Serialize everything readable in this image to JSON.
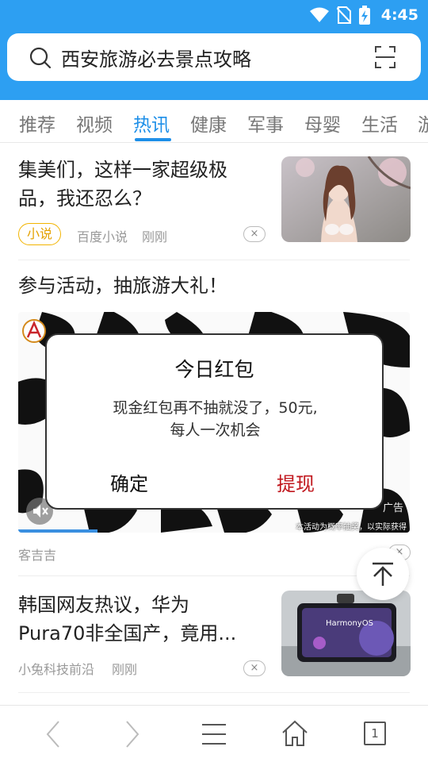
{
  "status_bar": {
    "time": "4:45"
  },
  "search": {
    "query": "西安旅游必去景点攻略"
  },
  "tabs": [
    {
      "label": "推荐",
      "active": false
    },
    {
      "label": "视频",
      "active": false
    },
    {
      "label": "热讯",
      "active": true
    },
    {
      "label": "健康",
      "active": false
    },
    {
      "label": "军事",
      "active": false
    },
    {
      "label": "母婴",
      "active": false
    },
    {
      "label": "生活",
      "active": false
    },
    {
      "label": "游",
      "active": false
    }
  ],
  "feed": {
    "item1": {
      "title_line1": "集美们，这样一家超级极",
      "title_line2": "品，我还忍么？",
      "tag": "小说",
      "source": "百度小说",
      "time": "刚刚",
      "dismiss": "×"
    },
    "item2": {
      "title": "参与活动，抽旅游大礼！",
      "source": "客吉吉",
      "video_caption": "本活动为概率抽奖，以实际获得为准",
      "ad_label": "广告",
      "dismiss": "×"
    },
    "item3": {
      "title_line1": "韩国网友热议，华为",
      "title_line2": "Pura70非全国产，竟用...",
      "source": "小兔科技前沿",
      "time": "刚刚",
      "thumb_text": "HarmonyOS",
      "dismiss": "×"
    }
  },
  "dialog": {
    "title": "今日红包",
    "message_line1": "现金红包再不抽就没了，50元,",
    "message_line2": "每人一次机会",
    "confirm": "确定",
    "withdraw": "提现"
  },
  "bottom_nav": {
    "page_count": "1"
  },
  "colors": {
    "header": "#2d9ff2",
    "active_tab": "#1e8fe8",
    "withdraw": "#c0161c",
    "tag": "#e4a100"
  }
}
